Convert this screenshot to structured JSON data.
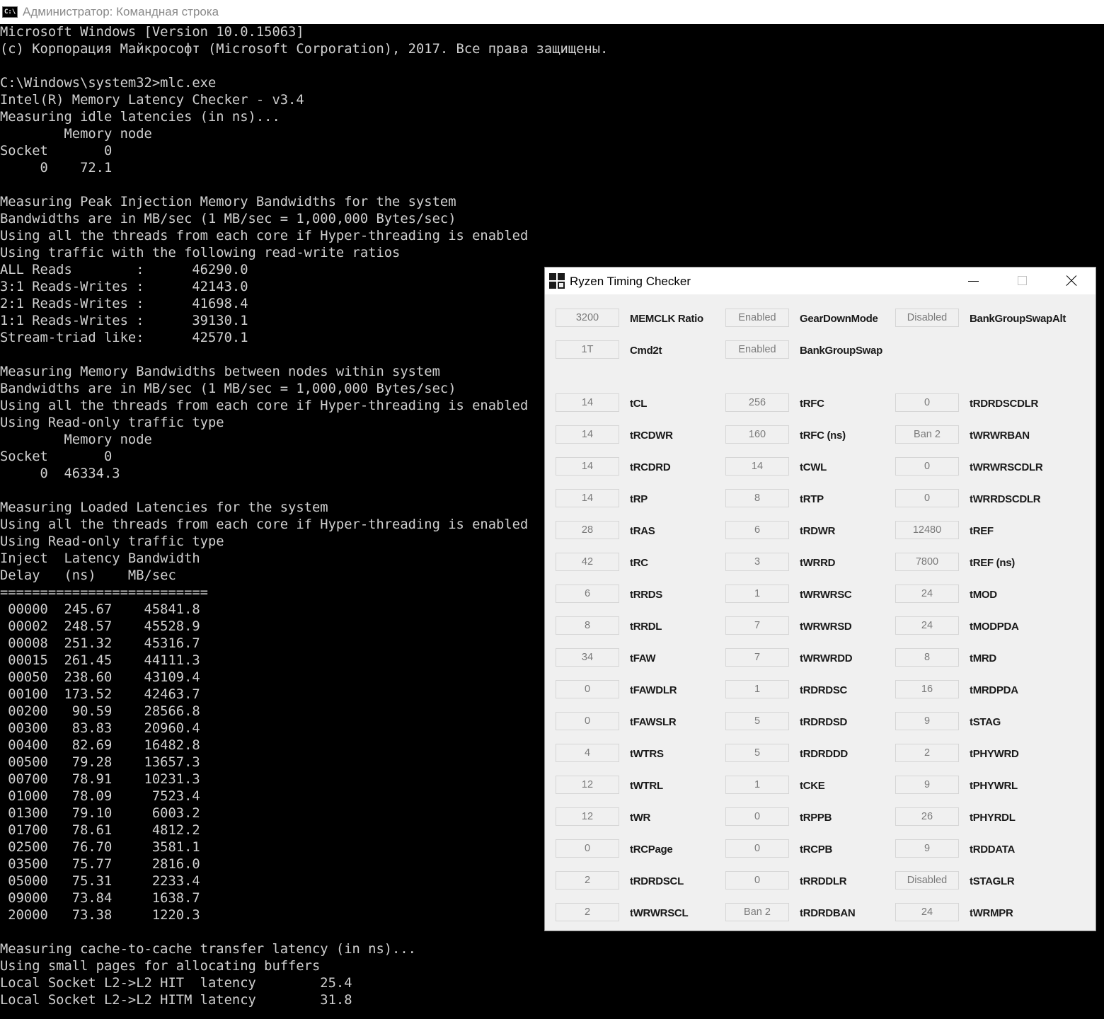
{
  "console_window": {
    "title": "Администратор: Командная строка",
    "icon": "C:\\",
    "output": "Microsoft Windows [Version 10.0.15063]\n(c) Корпорация Майкрософт (Microsoft Corporation), 2017. Все права защищены.\n\nC:\\Windows\\system32>mlc.exe\nIntel(R) Memory Latency Checker - v3.4\nMeasuring idle latencies (in ns)...\n        Memory node\nSocket       0\n     0    72.1\n\nMeasuring Peak Injection Memory Bandwidths for the system\nBandwidths are in MB/sec (1 MB/sec = 1,000,000 Bytes/sec)\nUsing all the threads from each core if Hyper-threading is enabled\nUsing traffic with the following read-write ratios\nALL Reads        :      46290.0\n3:1 Reads-Writes :      42143.0\n2:1 Reads-Writes :      41698.4\n1:1 Reads-Writes :      39130.1\nStream-triad like:      42570.1\n\nMeasuring Memory Bandwidths between nodes within system\nBandwidths are in MB/sec (1 MB/sec = 1,000,000 Bytes/sec)\nUsing all the threads from each core if Hyper-threading is enabled\nUsing Read-only traffic type\n        Memory node\nSocket       0\n     0  46334.3\n\nMeasuring Loaded Latencies for the system\nUsing all the threads from each core if Hyper-threading is enabled\nUsing Read-only traffic type\nInject  Latency Bandwidth\nDelay   (ns)    MB/sec\n==========================\n 00000  245.67    45841.8\n 00002  248.57    45528.9\n 00008  251.32    45316.7\n 00015  261.45    44111.3\n 00050  238.60    43109.4\n 00100  173.52    42463.7\n 00200   90.59    28566.8\n 00300   83.83    20960.4\n 00400   82.69    16482.8\n 00500   79.28    13657.3\n 00700   78.91    10231.3\n 01000   78.09     7523.4\n 01300   79.10     6003.2\n 01700   78.61     4812.2\n 02500   76.70     3581.1\n 03500   75.77     2816.0\n 05000   75.31     2233.4\n 09000   73.84     1638.7\n 20000   73.38     1220.3\n\nMeasuring cache-to-cache transfer latency (in ns)...\nUsing small pages for allocating buffers\nLocal Socket L2->L2 HIT  latency        25.4\nLocal Socket L2->L2 HITM latency        31.8"
  },
  "rtc_window": {
    "title": "Ryzen Timing Checker",
    "icon": "ryzen-logo-icon",
    "top_rows": [
      [
        {
          "value": "3200",
          "label": "MEMCLK Ratio"
        },
        {
          "value": "Enabled",
          "label": "GearDownMode"
        },
        {
          "value": "Disabled",
          "label": "BankGroupSwapAlt"
        }
      ],
      [
        {
          "value": "1T",
          "label": "Cmd2t"
        },
        {
          "value": "Enabled",
          "label": "BankGroupSwap"
        }
      ]
    ],
    "timing_rows": [
      [
        {
          "value": "14",
          "label": "tCL"
        },
        {
          "value": "256",
          "label": "tRFC"
        },
        {
          "value": "0",
          "label": "tRDRDSCDLR"
        }
      ],
      [
        {
          "value": "14",
          "label": "tRCDWR"
        },
        {
          "value": "160",
          "label": "tRFC (ns)"
        },
        {
          "value": "Ban 2",
          "label": "tWRWRBAN"
        }
      ],
      [
        {
          "value": "14",
          "label": "tRCDRD"
        },
        {
          "value": "14",
          "label": "tCWL"
        },
        {
          "value": "0",
          "label": "tWRWRSCDLR"
        }
      ],
      [
        {
          "value": "14",
          "label": "tRP"
        },
        {
          "value": "8",
          "label": "tRTP"
        },
        {
          "value": "0",
          "label": "tWRRDSCDLR"
        }
      ],
      [
        {
          "value": "28",
          "label": "tRAS"
        },
        {
          "value": "6",
          "label": "tRDWR"
        },
        {
          "value": "12480",
          "label": "tREF"
        }
      ],
      [
        {
          "value": "42",
          "label": "tRC"
        },
        {
          "value": "3",
          "label": "tWRRD"
        },
        {
          "value": "7800",
          "label": "tREF (ns)"
        }
      ],
      [
        {
          "value": "6",
          "label": "tRRDS"
        },
        {
          "value": "1",
          "label": "tWRWRSC"
        },
        {
          "value": "24",
          "label": "tMOD"
        }
      ],
      [
        {
          "value": "8",
          "label": "tRRDL"
        },
        {
          "value": "7",
          "label": "tWRWRSD"
        },
        {
          "value": "24",
          "label": "tMODPDA"
        }
      ],
      [
        {
          "value": "34",
          "label": "tFAW"
        },
        {
          "value": "7",
          "label": "tWRWRDD"
        },
        {
          "value": "8",
          "label": "tMRD"
        }
      ],
      [
        {
          "value": "0",
          "label": "tFAWDLR"
        },
        {
          "value": "1",
          "label": "tRDRDSC"
        },
        {
          "value": "16",
          "label": "tMRDPDA"
        }
      ],
      [
        {
          "value": "0",
          "label": "tFAWSLR"
        },
        {
          "value": "5",
          "label": "tRDRDSD"
        },
        {
          "value": "9",
          "label": "tSTAG"
        }
      ],
      [
        {
          "value": "4",
          "label": "tWTRS"
        },
        {
          "value": "5",
          "label": "tRDRDDD"
        },
        {
          "value": "2",
          "label": "tPHYWRD"
        }
      ],
      [
        {
          "value": "12",
          "label": "tWTRL"
        },
        {
          "value": "1",
          "label": "tCKE"
        },
        {
          "value": "9",
          "label": "tPHYWRL"
        }
      ],
      [
        {
          "value": "12",
          "label": "tWR"
        },
        {
          "value": "0",
          "label": "tRPPB"
        },
        {
          "value": "26",
          "label": "tPHYRDL"
        }
      ],
      [
        {
          "value": "0",
          "label": "tRCPage"
        },
        {
          "value": "0",
          "label": "tRCPB"
        },
        {
          "value": "9",
          "label": "tRDDATA"
        }
      ],
      [
        {
          "value": "2",
          "label": "tRDRDSCL"
        },
        {
          "value": "0",
          "label": "tRRDDLR"
        },
        {
          "value": "Disabled",
          "label": "tSTAGLR"
        }
      ],
      [
        {
          "value": "2",
          "label": "tWRWRSCL"
        },
        {
          "value": "Ban 2",
          "label": "tRDRDBAN"
        },
        {
          "value": "24",
          "label": "tWRMPR"
        }
      ]
    ]
  }
}
